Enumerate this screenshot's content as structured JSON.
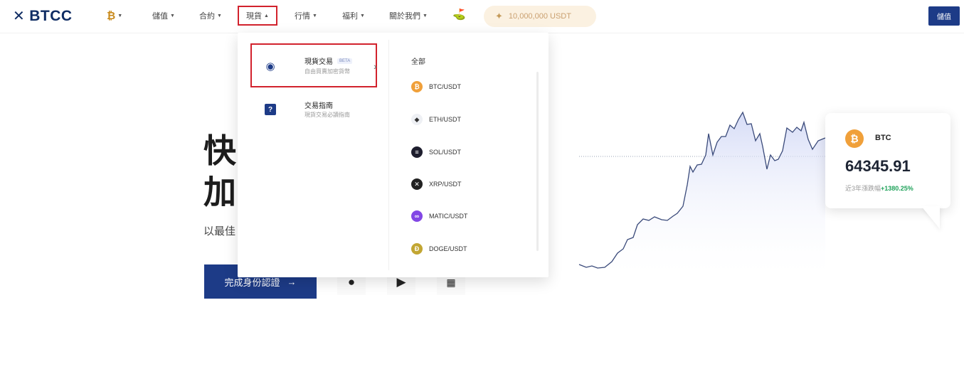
{
  "nav": {
    "logo": "BTCC",
    "items": [
      {
        "label": "儲值"
      },
      {
        "label": "合約"
      },
      {
        "label": "現貨"
      },
      {
        "label": "行情"
      },
      {
        "label": "福利"
      },
      {
        "label": "關於我們"
      }
    ],
    "reward": "10,000,000 USDT",
    "deposit_button": "儲值"
  },
  "hero": {
    "line1": "快",
    "line2": "加",
    "subtitle": "以最佳",
    "kyc_button": "完成身份認證",
    "kyc_arrow": "→"
  },
  "dropdown": {
    "items": [
      {
        "title": "現貨交易",
        "badge": "BETA",
        "desc": "自由買賣加密貨幣",
        "icon": "spot-trading-icon"
      },
      {
        "title": "交易指南",
        "desc": "現貨交易必讀指南",
        "icon": "guide-icon"
      }
    ],
    "right_heading": "全部",
    "pairs": [
      {
        "label": "BTC/USDT",
        "color": "#f0a03a",
        "icon": "btc-coin-icon"
      },
      {
        "label": "ETH/USDT",
        "color": "#9aa0ab",
        "icon": "eth-coin-icon"
      },
      {
        "label": "SOL/USDT",
        "color": "#1e1e2e",
        "icon": "sol-coin-icon"
      },
      {
        "label": "XRP/USDT",
        "color": "#222222",
        "icon": "xrp-coin-icon"
      },
      {
        "label": "MATIC/USDT",
        "color": "#8247e5",
        "icon": "matic-coin-icon"
      },
      {
        "label": "DOGE/USDT",
        "color": "#c2a633",
        "icon": "doge-coin-icon"
      }
    ]
  },
  "btc_card": {
    "symbol": "BTC",
    "price": "64345.91",
    "change_label": "近3年漲跌幅",
    "change_value": "+1380.25%"
  },
  "colors": {
    "brand": "#1d3b87",
    "highlight": "#d2222d",
    "positive": "#1fa25a"
  }
}
